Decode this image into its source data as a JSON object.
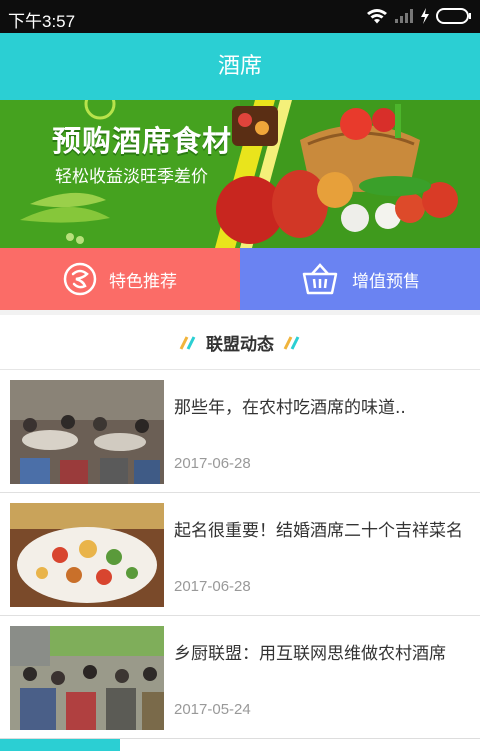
{
  "status_bar": {
    "time": "下午3:57"
  },
  "header": {
    "title": "酒席"
  },
  "banner": {
    "title": "预购酒席食材",
    "subtitle": "轻松收益淡旺季差价"
  },
  "shortcuts": [
    {
      "label": "特色推荐",
      "icon": "shrimp-icon",
      "color": "#fb6c67"
    },
    {
      "label": "增值预售",
      "icon": "basket-icon",
      "color": "#6a83f2"
    }
  ],
  "section": {
    "title": "联盟动态"
  },
  "news": [
    {
      "title": "那些年，在农村吃酒席的味道..",
      "date": "2017-06-28"
    },
    {
      "title": "起名很重要！结婚酒席二十个吉祥菜名",
      "date": "2017-06-28"
    },
    {
      "title": "乡厨联盟：用互联网思维做农村酒席",
      "date": "2017-05-24"
    }
  ],
  "colors": {
    "accent": "#2bcfd3"
  }
}
